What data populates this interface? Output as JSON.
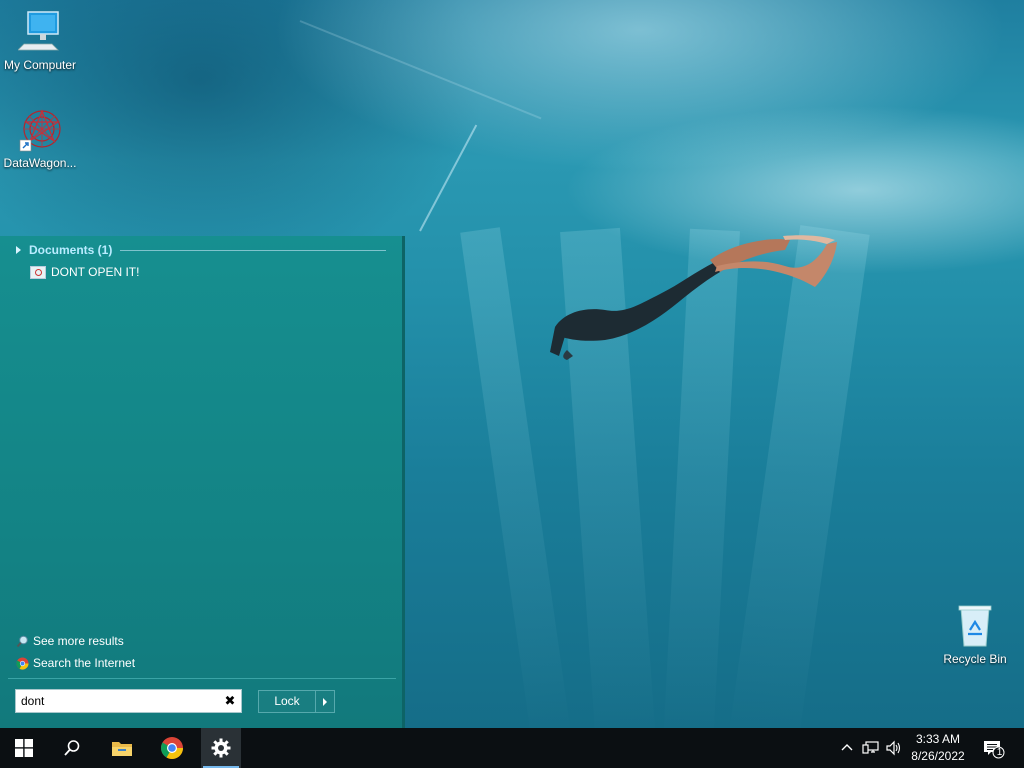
{
  "desktop": {
    "icons": [
      {
        "label": "My Computer",
        "icon": "computer-icon"
      },
      {
        "label": "DataWagon...",
        "icon": "datawagon-shortcut-icon"
      },
      {
        "label": "Recycle Bin",
        "icon": "recycle-bin-icon"
      }
    ]
  },
  "start_menu": {
    "documents_header": "Documents (1)",
    "results": [
      {
        "label": "DONT OPEN IT!",
        "icon": "image-file-icon"
      }
    ],
    "see_more": "See more results",
    "search_internet": "Search the Internet",
    "search": {
      "value": "dont",
      "clear_icon": "close-icon"
    },
    "lock_label": "Lock"
  },
  "taskbar": {
    "pinned": [
      "start-icon",
      "search-icon",
      "file-explorer-icon",
      "chrome-icon",
      "settings-icon"
    ],
    "tray": [
      "chevron-up-icon",
      "network-icon",
      "volume-icon"
    ],
    "time": "3:33 AM",
    "date": "8/26/2022",
    "notification_count": "1"
  },
  "colors": {
    "start_menu_bg": "#138385",
    "taskbar_bg": "#0b0f12",
    "header_text": "#b9ecff",
    "active_indicator": "#76b9ed"
  }
}
